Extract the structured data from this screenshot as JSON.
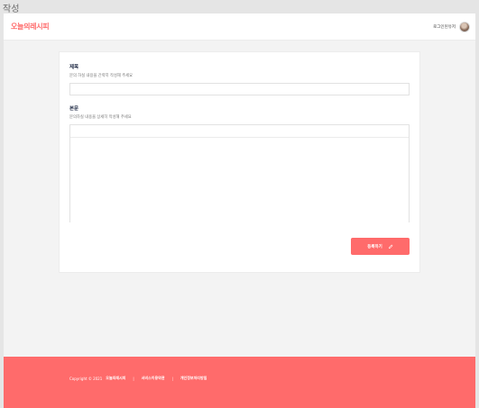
{
  "frame_label": "작성",
  "header": {
    "logo": "오늘의레시피",
    "username": "로그인된유저"
  },
  "form": {
    "title_label": "제목",
    "title_desc": "문의 하실 내용을 간략히 작성해 주세요",
    "title_value": "",
    "body_label": "본문",
    "body_desc": "문의하실 내용을 상세히 작성해 주세요",
    "body_value": "",
    "submit_label": "등록하기"
  },
  "footer": {
    "copyright": "Copyright © 2021",
    "brand": "오늘의레시피",
    "separator": "|",
    "terms_link": "서비스이용약관",
    "privacy_link": "개인정보처리방침"
  },
  "colors": {
    "accent": "#ff6b6b",
    "heading": "#1f2a44"
  },
  "icons": {
    "avatar": "user-avatar",
    "submit": "pencil-icon"
  }
}
